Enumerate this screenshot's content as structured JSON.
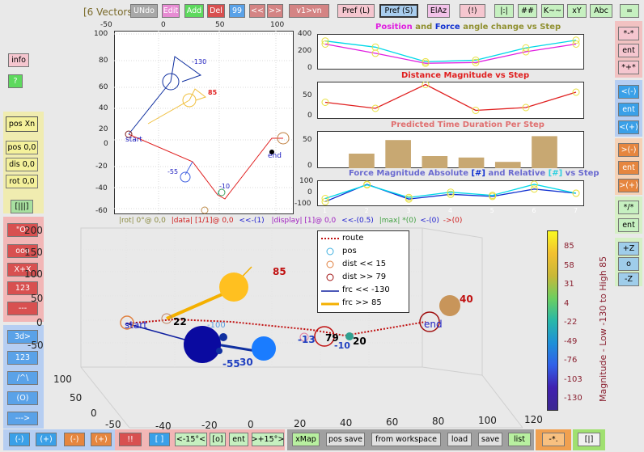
{
  "toolbar": {
    "vectors_label": "[6 Vectors",
    "undo": "UNdo",
    "edit": "Edit",
    "add": "Add",
    "del": "Del",
    "count": "99",
    "prev": "<<",
    "next": ">>",
    "v1vn": "v1>vn",
    "pref_l": "Pref (L)",
    "pref_s": "Pref (S)",
    "elaz": "ElAz",
    "bang": "(!)",
    "bar": "|:|",
    "hash": "##",
    "k": "K~~",
    "xy": "xY",
    "abc": "Abc",
    "eq": "="
  },
  "left_panel": {
    "info": "info",
    "help": "?",
    "pos_xn": "pos Xn",
    "pos00": "pos 0,0",
    "dis00": "dis 0,0",
    "rot00": "rot 0,0",
    "brk": "[|||]",
    "red_btns": [
      "\"O\"",
      "ooo",
      "X+X",
      "123",
      "---"
    ],
    "blue_btns": [
      "3d>",
      "123",
      "/^\\",
      "(O)",
      "--->"
    ]
  },
  "right_panel": {
    "top": [
      "*-*",
      "ent",
      "*+*"
    ],
    "blue": [
      "<(-)",
      "ent",
      "<(+)"
    ],
    "orange": [
      ">(-)",
      "ent",
      ">(+)"
    ],
    "mid": [
      "*/*",
      "ent"
    ],
    "z": [
      "+Z",
      "o",
      "-Z"
    ]
  },
  "bottom_bar": {
    "minus_b": "(-)",
    "plus_b": "(+)",
    "minus_o": "(-)",
    "plus_o": "(+)",
    "bang": "!!",
    "brackets": "[ ]",
    "rot_l": "<-15°<",
    "o": "[o]",
    "ent": "ent",
    "rot_r": ">+15°>",
    "xmap": "xMap",
    "pos_save": "pos save",
    "from_ws": "from workspace",
    "load": "load",
    "save": "save",
    "list": "list",
    "star": "-*.",
    "brk2": "[|]"
  },
  "plot2d": {
    "xticks": [
      "-50",
      "0",
      "50",
      "100"
    ],
    "yticks": [
      "100",
      "80",
      "60",
      "40",
      "20",
      "0",
      "-20",
      "-40",
      "-60"
    ],
    "labels": {
      "start": "start",
      "end": "end",
      "a": "-130",
      "b": "85",
      "c": "-55",
      "d": "-10"
    },
    "status": {
      "rot": "|rot| 0°@ 0,0",
      "data": "|data| [1/1]@ 0,0",
      "data_step": "<<-(1)",
      "display": "|display| [1]@ 0,0",
      "display_step": "<<-(0.5)",
      "max": "|max| *(0)",
      "max_l": "<-(0)",
      "max_r": "->(0)"
    }
  },
  "chart_data": [
    {
      "type": "line",
      "title": "Position and Force angle change vs Step",
      "title_parts": [
        "Position",
        "and",
        "Force",
        "angle change vs Step"
      ],
      "ylim": [
        0,
        400
      ],
      "yticks": [
        "400",
        "200",
        "0"
      ],
      "x": [
        1,
        2,
        3,
        4,
        5,
        6
      ],
      "series": [
        {
          "color": "#00d8e8",
          "values": [
            340,
            260,
            70,
            90,
            250,
            350
          ]
        },
        {
          "color": "#e020e0",
          "values": [
            300,
            180,
            50,
            60,
            200,
            300
          ]
        }
      ]
    },
    {
      "type": "line",
      "title": "Distance Magnitude vs Step",
      "ylim": [
        0,
        80
      ],
      "yticks": [
        "50",
        "0"
      ],
      "x": [
        1,
        2,
        3,
        4,
        5,
        6
      ],
      "series": [
        {
          "color": "#e02020",
          "values": [
            35,
            20,
            79,
            15,
            22,
            60
          ]
        }
      ]
    },
    {
      "type": "bar",
      "title": "Predicted Time Duration Per Step",
      "ylim": [
        0,
        70
      ],
      "yticks": [
        "50",
        "0"
      ],
      "categories": [
        "1",
        "2",
        "3",
        "4",
        "5",
        "6",
        "7"
      ],
      "values": [
        30,
        58,
        25,
        22,
        13,
        66,
        0
      ]
    },
    {
      "type": "line",
      "title": "Force Magnitude Absolute [#] and Relative [#] vs Step",
      "title_parts": [
        "Force Magnitude Absolute",
        "[#]",
        "and Relative",
        "[#]",
        "vs Step"
      ],
      "ylim": [
        -100,
        100
      ],
      "yticks": [
        "100",
        "0",
        "-100"
      ],
      "xticks": [
        "1",
        "2",
        "3",
        "4",
        "5",
        "6",
        "7"
      ],
      "x": [
        1,
        2,
        3,
        4,
        5,
        6,
        7
      ],
      "series": [
        {
          "color": "#1030d0",
          "values": [
            -80,
            85,
            -55,
            -10,
            -30,
            40,
            0
          ]
        },
        {
          "color": "#00d8e8",
          "values": [
            -50,
            80,
            -40,
            10,
            -20,
            85,
            0
          ]
        }
      ]
    }
  ],
  "plot3d": {
    "zticks": [
      "200",
      "150",
      "100",
      "50",
      "0",
      "-50"
    ],
    "xticks": [
      "-40",
      "-20",
      "0",
      "20",
      "40",
      "60",
      "80",
      "100",
      "120"
    ],
    "yticks": [
      "100",
      "50",
      "0",
      "-50"
    ],
    "labels": {
      "start": "start",
      "end": "end",
      "n22": "22",
      "n85": "85",
      "n40": "40",
      "n79": "79",
      "n20": "20",
      "n55": "-55",
      "n30": "30",
      "n13": "-13",
      "n10": "-10",
      "nm": "-100"
    },
    "legend": [
      "route",
      "pos",
      "dist << 15",
      "dist >> 79",
      "frc << -130",
      "frc >> 85"
    ],
    "colorbar_ticks": [
      "85",
      "58",
      "31",
      "4",
      "-22",
      "-49",
      "-76",
      "-103",
      "-130"
    ],
    "colorbar_label": "Magnitude - Low -130 to High 85"
  }
}
